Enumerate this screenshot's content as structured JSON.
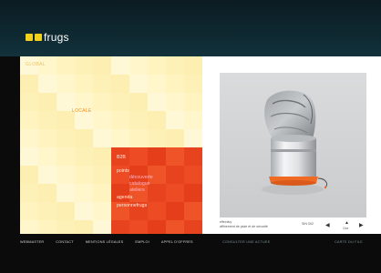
{
  "header": {
    "brand": "frugs",
    "logo_color": "#f2d11c"
  },
  "mosaic": {
    "label_global": "GLOBAL",
    "label_locale": "LOCALE",
    "colors": {
      "global": "#fff4c4",
      "locale": "#fbe85a",
      "b2b": "#ec4b23"
    },
    "menu": [
      {
        "label": "B2B",
        "sub": []
      },
      {
        "label": "points",
        "sub": [
          "découverte",
          "catalogue",
          "ateliers"
        ]
      },
      {
        "label": "agenda",
        "sub": []
      },
      {
        "label": "personnefrugs",
        "sub": []
      }
    ]
  },
  "product": {
    "name": "effecticy",
    "description": "affinement de pluie et de sécurité",
    "ref": "SIN 002",
    "count": "1/xx",
    "prev_icon": "arrow-left-icon",
    "up_icon": "arrow-up-icon",
    "next_icon": "arrow-right-icon"
  },
  "footer": {
    "links": [
      "WEBMASTER",
      "CONTACT",
      "MENTIONS LÉGALES",
      "EMPLOI",
      "APPEL D'OFFRES"
    ],
    "action": "CONSULTER UNE ACTUEE",
    "right": "CARTE DU FILE"
  }
}
